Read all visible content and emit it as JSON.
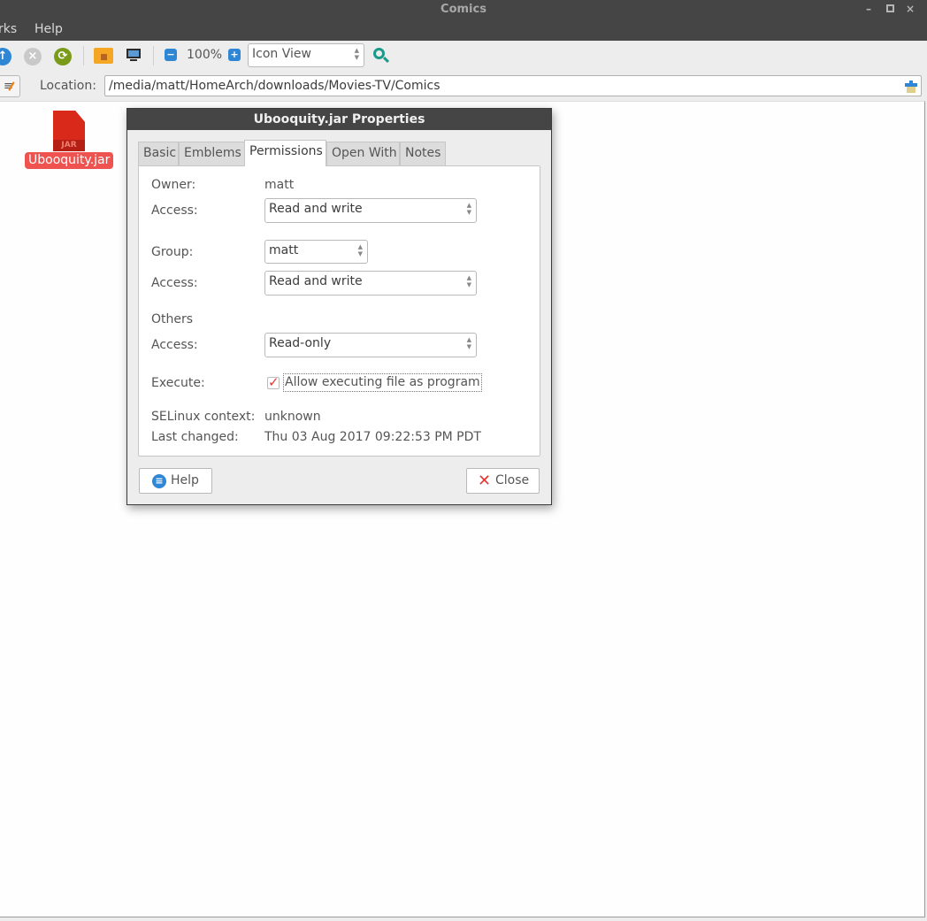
{
  "window": {
    "title": "Comics",
    "controls": {
      "minimize": "–",
      "maximize": "□",
      "close": "×"
    }
  },
  "menubar": {
    "items": [
      "rks",
      "Help"
    ]
  },
  "toolbar": {
    "icons": [
      "up-arrow-icon",
      "stop-icon",
      "reload-icon",
      "home-folder-icon",
      "computer-icon"
    ],
    "zoom_out_glyph": "−",
    "zoom_level": "100%",
    "zoom_in_glyph": "+",
    "view_mode": "Icon View",
    "search_glyph": "search-icon"
  },
  "location": {
    "label": "Location:",
    "value": "/media/matt/HomeArch/downloads/Movies-TV/Comics"
  },
  "files": [
    {
      "name": "Ubooquity.jar",
      "type_label": "JAR",
      "selected": true
    }
  ],
  "dialog": {
    "title": "Ubooquity.jar Properties",
    "tabs": [
      {
        "label": "Basic",
        "active": false
      },
      {
        "label": "Emblems",
        "active": false
      },
      {
        "label": "Permissions",
        "active": true
      },
      {
        "label": "Open With",
        "active": false
      },
      {
        "label": "Notes",
        "active": false
      }
    ],
    "permissions": {
      "owner_label": "Owner:",
      "owner_value": "matt",
      "owner_access_label": "Access:",
      "owner_access_value": "Read and write",
      "group_label": "Group:",
      "group_value": "matt",
      "group_access_label": "Access:",
      "group_access_value": "Read and write",
      "others_label": "Others",
      "others_access_label": "Access:",
      "others_access_value": "Read-only",
      "execute_label": "Execute:",
      "execute_checkbox_label": "Allow executing file as program",
      "execute_checked": true,
      "selinux_label": "SELinux context:",
      "selinux_value": "unknown",
      "last_changed_label": "Last changed:",
      "last_changed_value": "Thu 03 Aug 2017 09:22:53 PM PDT"
    },
    "buttons": {
      "help": "Help",
      "close": "Close"
    }
  }
}
